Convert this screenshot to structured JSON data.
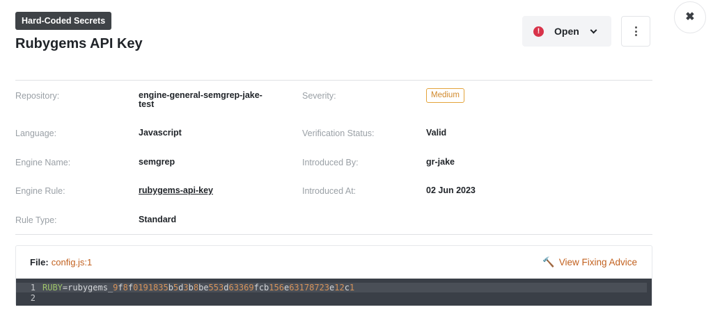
{
  "header": {
    "badge": "Hard-Coded Secrets",
    "title": "Rubygems API Key",
    "status_label": "Open",
    "status_icon": "alert-circle-icon",
    "colors": {
      "status_alert": "#d8334a",
      "accent": "#c2611f",
      "severity": "#e3a33a"
    }
  },
  "details": {
    "repository_label": "Repository:",
    "repository_value": "engine-general-semgrep-jake-test",
    "severity_label": "Severity:",
    "severity_value": "Medium",
    "language_label": "Language:",
    "language_value": "Javascript",
    "verification_label": "Verification Status:",
    "verification_value": "Valid",
    "engine_name_label": "Engine Name:",
    "engine_name_value": "semgrep",
    "introduced_by_label": "Introduced By:",
    "introduced_by_value": "gr-jake",
    "engine_rule_label": "Engine Rule:",
    "engine_rule_value": "rubygems-api-key",
    "introduced_at_label": "Introduced At:",
    "introduced_at_value": "02 Jun 2023",
    "rule_type_label": "Rule Type:",
    "rule_type_value": "Standard"
  },
  "file": {
    "label": "File:",
    "name": "config.js:1",
    "advice_label": "View Fixing Advice",
    "code_lines": [
      {
        "number": "1",
        "var": "RUBY",
        "eq": "=",
        "text": "rubygems_9f8f0191835b5d3b8be553d63369fcb156e63178723e12c1"
      },
      {
        "number": "2",
        "var": "",
        "eq": "",
        "text": ""
      }
    ]
  }
}
